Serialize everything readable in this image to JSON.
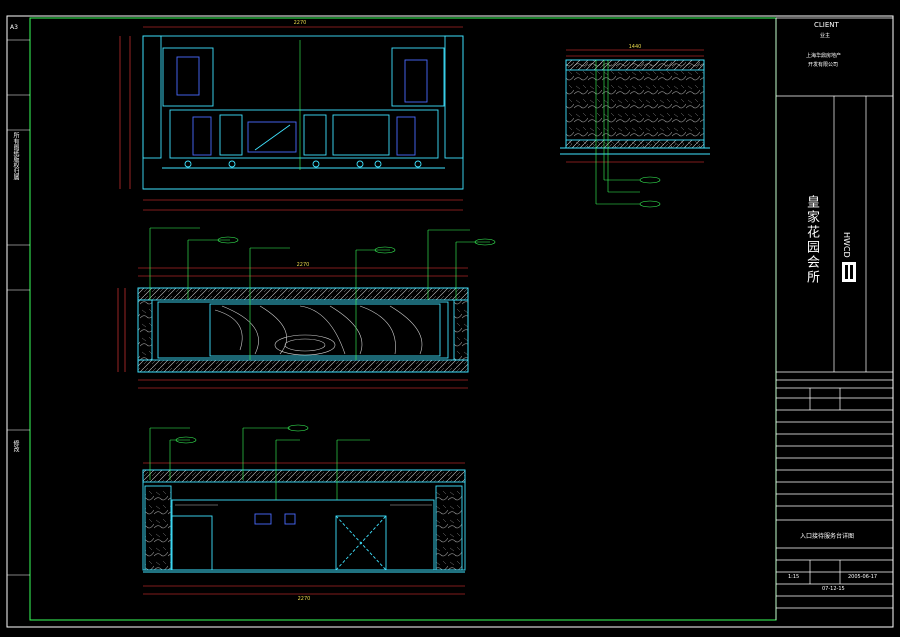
{
  "colors": {
    "background": "#000000",
    "frame": "#ffffff",
    "inner_frame": "#39ff5a",
    "drawing_line": "#3fe3ff",
    "dimension": "#ff3b3b",
    "leader": "#39ff5a",
    "label": "#e8d84a",
    "hatch": "#bfbfbf"
  },
  "title_block": {
    "client_label": "CLIENT",
    "client_cn": "业主",
    "client_name_1": "上海华鼎房地产",
    "client_name_2": "开发有限公司",
    "project_name": "皇家花园会所",
    "firm_logo": "HWCD",
    "drawing_title": "入口接待服务台详图",
    "scale_value": "1:15",
    "date_value": "2005-06-17",
    "revision": "07-12-15"
  },
  "margin_labels": {
    "top_left": "A3",
    "left_mid": "所有图纸版权归属",
    "left_low": "修改"
  },
  "views": {
    "elevation_a": {
      "total_dim": "2270"
    },
    "elevation_b": {
      "total_dim": "2270"
    },
    "elevation_c": {
      "total_dim": "2270"
    },
    "section": {
      "total_dim": "1440"
    }
  }
}
